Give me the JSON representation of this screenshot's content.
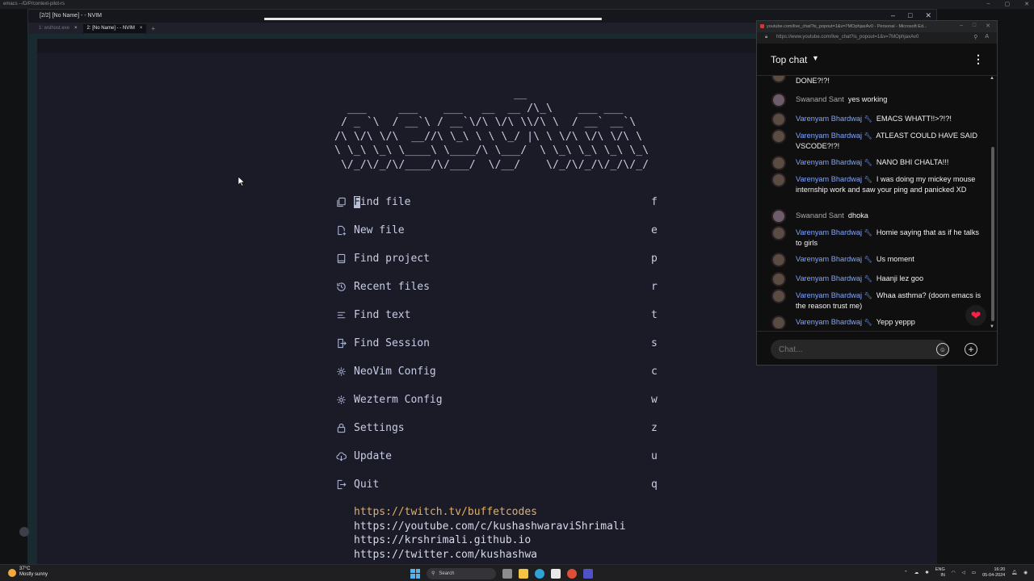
{
  "os_window": {
    "title": "emacs --/D/P/context-pilot-rs"
  },
  "terminal": {
    "title": "[2/2] [No Name] - - NVIM",
    "tabs": [
      {
        "label": "1: wslhost.exe",
        "active": false
      },
      {
        "label": "2: [No Name] - - NVIM",
        "active": true
      }
    ],
    "tab_close": "×",
    "tab_add": "+"
  },
  "dashboard": {
    "ascii_art": "                            __\n  ___     ___    ___   __  __ /\\_\\    ___ ___\n / _ `\\  / __`\\ / __`\\/\\ \\/\\ \\\\/\\ \\  / __` __`\\\n/\\ \\/\\ \\/\\  __//\\ \\_\\ \\ \\ \\_/ |\\ \\ \\/\\ \\/\\ \\/\\ \\\n\\ \\_\\ \\_\\ \\____\\ \\____/\\ \\___/  \\ \\_\\ \\_\\ \\_\\ \\_\\\n \\/_/\\/_/\\/____/\\/___/  \\/__/    \\/_/\\/_/\\/_/\\/_/",
    "items": [
      {
        "icon": "file-copy-icon",
        "label": "Find file",
        "key": "f"
      },
      {
        "icon": "new-file-icon",
        "label": "New file",
        "key": "e"
      },
      {
        "icon": "book-icon",
        "label": "Find project",
        "key": "p"
      },
      {
        "icon": "history-icon",
        "label": "Recent files",
        "key": "r"
      },
      {
        "icon": "lines-icon",
        "label": "Find text",
        "key": "t"
      },
      {
        "icon": "session-icon",
        "label": "Find Session",
        "key": "s"
      },
      {
        "icon": "gear-icon",
        "label": "NeoVim Config",
        "key": "c"
      },
      {
        "icon": "gear-icon",
        "label": "Wezterm Config",
        "key": "w"
      },
      {
        "icon": "lock-icon",
        "label": "Settings",
        "key": "z"
      },
      {
        "icon": "cloud-download-icon",
        "label": "Update",
        "key": "u"
      },
      {
        "icon": "exit-icon",
        "label": "Quit",
        "key": "q"
      }
    ],
    "links": [
      "https://twitch.tv/buffetcodes",
      "https://youtube.com/c/kushashwaraviShrimali",
      "https://krshrimali.github.io",
      "https://twitter.com/kushashwa"
    ]
  },
  "chat_window": {
    "title": "youtube.com/live_chat?is_popout=1&v=7MOphjaxAv0 - Personal - Microsoft Ed...",
    "url": "https://www.youtube.com/live_chat?is_popout=1&v=7MOphjaxAv0",
    "header": "Top chat",
    "messages": [
      {
        "author": "",
        "text": "DONE?!?!",
        "mod": false
      },
      {
        "author": "Swanand Sant",
        "text": "yes working",
        "mod": false
      },
      {
        "author": "Varenyam Bhardwaj",
        "text": "EMACS WHATT!!>?!?!",
        "mod": true
      },
      {
        "author": "Varenyam Bhardwaj",
        "text": "ATLEAST COULD HAVE SAID VSCODE?!?!",
        "mod": true
      },
      {
        "author": "Varenyam Bhardwaj",
        "text": "NANO BHI CHALTA!!!",
        "mod": true
      },
      {
        "author": "Varenyam Bhardwaj",
        "text": "I was doing my mickey mouse internship work and saw your ping and panicked XD",
        "mod": true
      },
      {
        "author": "Swanand Sant",
        "text": "dhoka",
        "mod": false
      },
      {
        "author": "Varenyam Bhardwaj",
        "text": "Homie saying that as if he talks to girls",
        "mod": true
      },
      {
        "author": "Varenyam Bhardwaj",
        "text": "Us moment",
        "mod": true
      },
      {
        "author": "Varenyam Bhardwaj",
        "text": "Haanji lez goo",
        "mod": true
      },
      {
        "author": "Varenyam Bhardwaj",
        "text": "Whaa asthma? (doom emacs is the reason trust me)",
        "mod": true
      },
      {
        "author": "Varenyam Bhardwaj",
        "text": "Yepp yeppp",
        "mod": true
      }
    ],
    "input_placeholder": "Chat..."
  },
  "taskbar": {
    "temperature": "37°C",
    "weather": "Mostly sunny",
    "search_label": "Search",
    "lang_top": "ENG",
    "lang_bottom": "IN",
    "time": "16:20",
    "date": "05-04-2024"
  },
  "colors": {
    "bg": "#1a1b26",
    "fg": "#c8cde6",
    "link_accent": "#e0af68",
    "mod_name": "#80a6ff"
  }
}
